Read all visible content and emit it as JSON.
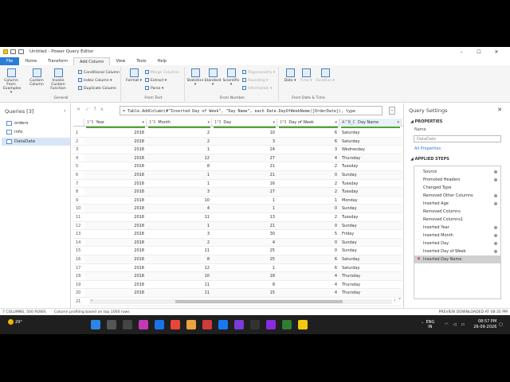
{
  "titlebar": {
    "title": "Untitled - Power Query Editor",
    "minimize": "–",
    "maximize": "☐",
    "close": "✕"
  },
  "menu": {
    "tabs": [
      "File",
      "Home",
      "Transform",
      "Add Column",
      "View",
      "Tools",
      "Help"
    ],
    "active": "Add Column"
  },
  "ribbon": {
    "general": {
      "label": "General",
      "column_from_examples": "Column From Examples ▾",
      "custom_column": "Custom Column",
      "invoke_custom_function": "Invoke Custom Function",
      "conditional_column": "Conditional Column",
      "index_column": "Index Column ▾",
      "duplicate_column": "Duplicate Column"
    },
    "from_text": {
      "label": "From Text",
      "format": "Format ▾",
      "merge_columns": "Merge Columns",
      "extract": "Extract ▾",
      "parse": "Parse ▾"
    },
    "from_number": {
      "label": "From Number",
      "statistics": "Statistics ▾",
      "standard": "Standard ▾",
      "scientific": "Scientific ▾",
      "trigonometry": "Trigonometry ▾",
      "rounding": "Rounding ▾",
      "information": "Information ▾"
    },
    "from_date_time": {
      "label": "From Date & Time",
      "date": "Date ▾",
      "time": "Time ▾",
      "duration": "Duration ▾"
    }
  },
  "queries": {
    "header": "Queries [3]",
    "collapse": "‹",
    "items": [
      "orders",
      "info",
      "DataDate"
    ],
    "selected": "DataDate"
  },
  "formula": {
    "cancel": "✕",
    "commit": "✓",
    "fx": "fx",
    "text": "= Table.AddColumn(#\"Inserted Day of Week\", \"Day Name\", each Date.DayOfWeekName([OrderDate]), type",
    "expand": "⌄"
  },
  "grid": {
    "columns": [
      {
        "type": "1²3",
        "name": "Year"
      },
      {
        "type": "1²3",
        "name": "Month"
      },
      {
        "type": "1²3",
        "name": "Day"
      },
      {
        "type": "1²3",
        "name": "Day of Week"
      },
      {
        "type": "A^B_C",
        "name": "Day Name"
      }
    ],
    "rows": [
      [
        "1",
        "2018",
        "2",
        "10",
        "6",
        "Saturday"
      ],
      [
        "2",
        "2018",
        "2",
        "3",
        "6",
        "Saturday"
      ],
      [
        "3",
        "2018",
        "1",
        "24",
        "3",
        "Wednesday"
      ],
      [
        "4",
        "2018",
        "12",
        "27",
        "4",
        "Thursday"
      ],
      [
        "5",
        "2018",
        "8",
        "21",
        "2",
        "Tuesday"
      ],
      [
        "6",
        "2018",
        "1",
        "21",
        "0",
        "Sunday"
      ],
      [
        "7",
        "2018",
        "1",
        "16",
        "2",
        "Tuesday"
      ],
      [
        "8",
        "2018",
        "3",
        "27",
        "2",
        "Tuesday"
      ],
      [
        "9",
        "2018",
        "10",
        "1",
        "1",
        "Monday"
      ],
      [
        "10",
        "2018",
        "4",
        "1",
        "0",
        "Sunday"
      ],
      [
        "11",
        "2018",
        "11",
        "13",
        "2",
        "Tuesday"
      ],
      [
        "12",
        "2018",
        "1",
        "21",
        "0",
        "Sunday"
      ],
      [
        "13",
        "2018",
        "3",
        "30",
        "5",
        "Friday"
      ],
      [
        "14",
        "2018",
        "2",
        "4",
        "0",
        "Sunday"
      ],
      [
        "15",
        "2018",
        "11",
        "25",
        "0",
        "Sunday"
      ],
      [
        "16",
        "2018",
        "8",
        "25",
        "6",
        "Saturday"
      ],
      [
        "17",
        "2018",
        "12",
        "1",
        "6",
        "Saturday"
      ],
      [
        "18",
        "2018",
        "10",
        "18",
        "4",
        "Thursday"
      ],
      [
        "19",
        "2018",
        "11",
        "8",
        "4",
        "Thursday"
      ],
      [
        "20",
        "2018",
        "11",
        "15",
        "4",
        "Thursday"
      ],
      [
        "21",
        "",
        "",
        "",
        "",
        ""
      ]
    ],
    "scroll_left": "‹",
    "scroll_right": "›",
    "scroll_down": "⌄"
  },
  "settings": {
    "header": "Query Settings",
    "close": "✕",
    "properties_label": "◢ PROPERTIES",
    "name_label": "Name",
    "name_value": "DataDate",
    "all_properties": "All Properties",
    "applied_steps_label": "◢ APPLIED STEPS",
    "steps": [
      "Source",
      "Promoted Headers",
      "Changed Type",
      "Removed Other Columns",
      "Inserted Age",
      "Removed Columns",
      "Removed Columns1",
      "Inserted Year",
      "Inserted Month",
      "Inserted Day",
      "Inserted Day of Week",
      "Inserted Day Name"
    ],
    "selected_step": "Inserted Day Name"
  },
  "status": {
    "left": "7 COLUMNS, 500 ROWS",
    "middle": "Column profiling based on top 1000 rows",
    "right": "PREVIEW DOWNLOADED AT 08:35 PM"
  },
  "taskbar": {
    "temp": "29°",
    "lang1": "ENG",
    "lang2": "IN",
    "time": "08:57 PM",
    "date": "26-09-2026"
  },
  "colors": {
    "accent": "#2b7cd3",
    "quality_bar": "#4ea72e",
    "selected_query": "#d7e6f7"
  }
}
